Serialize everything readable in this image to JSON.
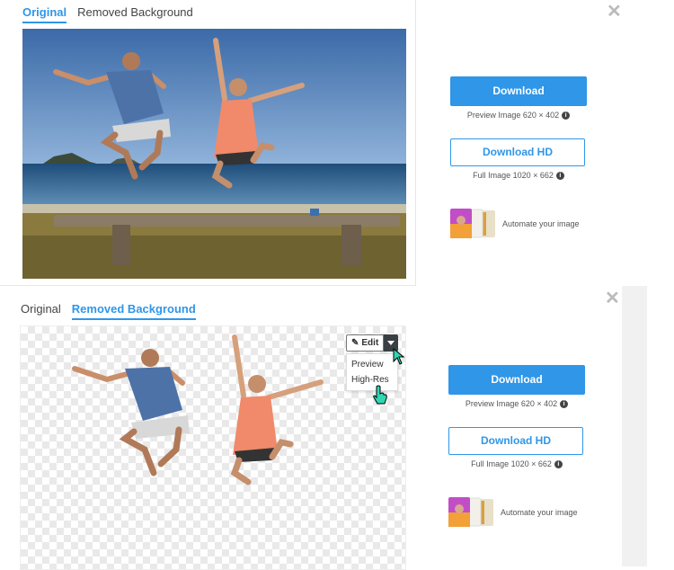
{
  "top": {
    "tabs": [
      {
        "label": "Original",
        "active": true
      },
      {
        "label": "Removed Background",
        "active": false
      }
    ],
    "close_symbol": "✕",
    "download_label": "Download",
    "preview_info": "Preview Image 620 × 402",
    "download_hd_label": "Download HD",
    "full_info": "Full Image 1020 × 662",
    "automate_label": "Automate your image"
  },
  "bottom": {
    "tabs": [
      {
        "label": "Original",
        "active": false
      },
      {
        "label": "Removed Background",
        "active": true
      }
    ],
    "close_symbol": "✕",
    "edit_label": "Edit",
    "menu_items": [
      "Preview",
      "High-Res"
    ],
    "download_label": "Download",
    "preview_info": "Preview Image 620 × 402",
    "download_hd_label": "Download HD",
    "full_info": "Full Image 1020 × 662",
    "automate_label": "Automate your image"
  },
  "icons": {
    "info": "info-icon",
    "pencil": "pencil-icon",
    "caret": "caret-down-icon",
    "close": "close-icon",
    "cursor": "pointer-cursor-icon"
  },
  "colors": {
    "accent": "#2f96e8",
    "edit_caret_bg": "#3a3f44"
  }
}
